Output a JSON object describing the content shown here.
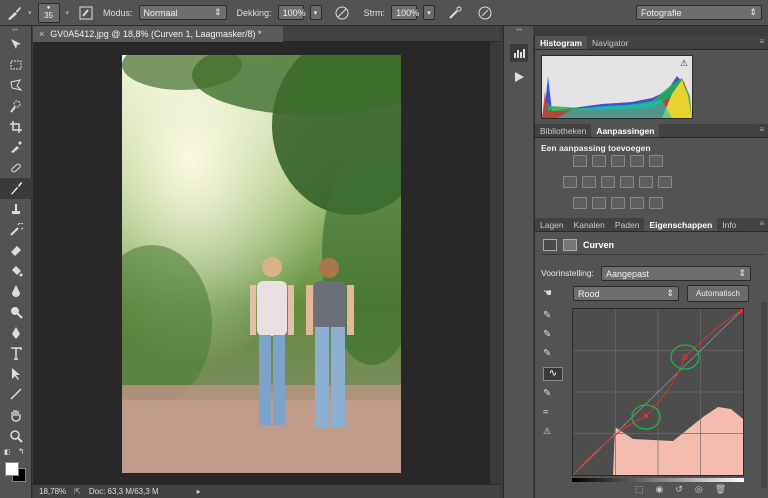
{
  "options_bar": {
    "brush_size": "35",
    "mode_label": "Modus:",
    "mode_value": "Normaal",
    "opacity_label": "Dekking:",
    "opacity_value": "100%",
    "flow_label": "Strm:",
    "flow_value": "100%",
    "workspace": "Fotografie"
  },
  "document": {
    "tab_title": "GV0A5412.jpg @ 18,8% (Curven 1, Laagmasker/8) *",
    "zoom": "18,78%",
    "doc_info": "Doc: 63,3 M/63,3 M"
  },
  "panels": {
    "histogram_tabs": [
      "Histogram",
      "Navigator"
    ],
    "adjust_tabs": [
      "Bibliotheken",
      "Aanpassingen"
    ],
    "adjust_title": "Een aanpassing toevoegen",
    "layers_tabs": [
      "Lagen",
      "Kanalen",
      "Paden",
      "Eigenschappen",
      "Info"
    ],
    "curves_title": "Curven",
    "preset_label": "Voorinstelling:",
    "preset_value": "Aangepast",
    "channel_value": "Rood",
    "auto_button": "Automatisch"
  },
  "colors": {
    "accent": "#e03030",
    "panel": "#535353"
  }
}
